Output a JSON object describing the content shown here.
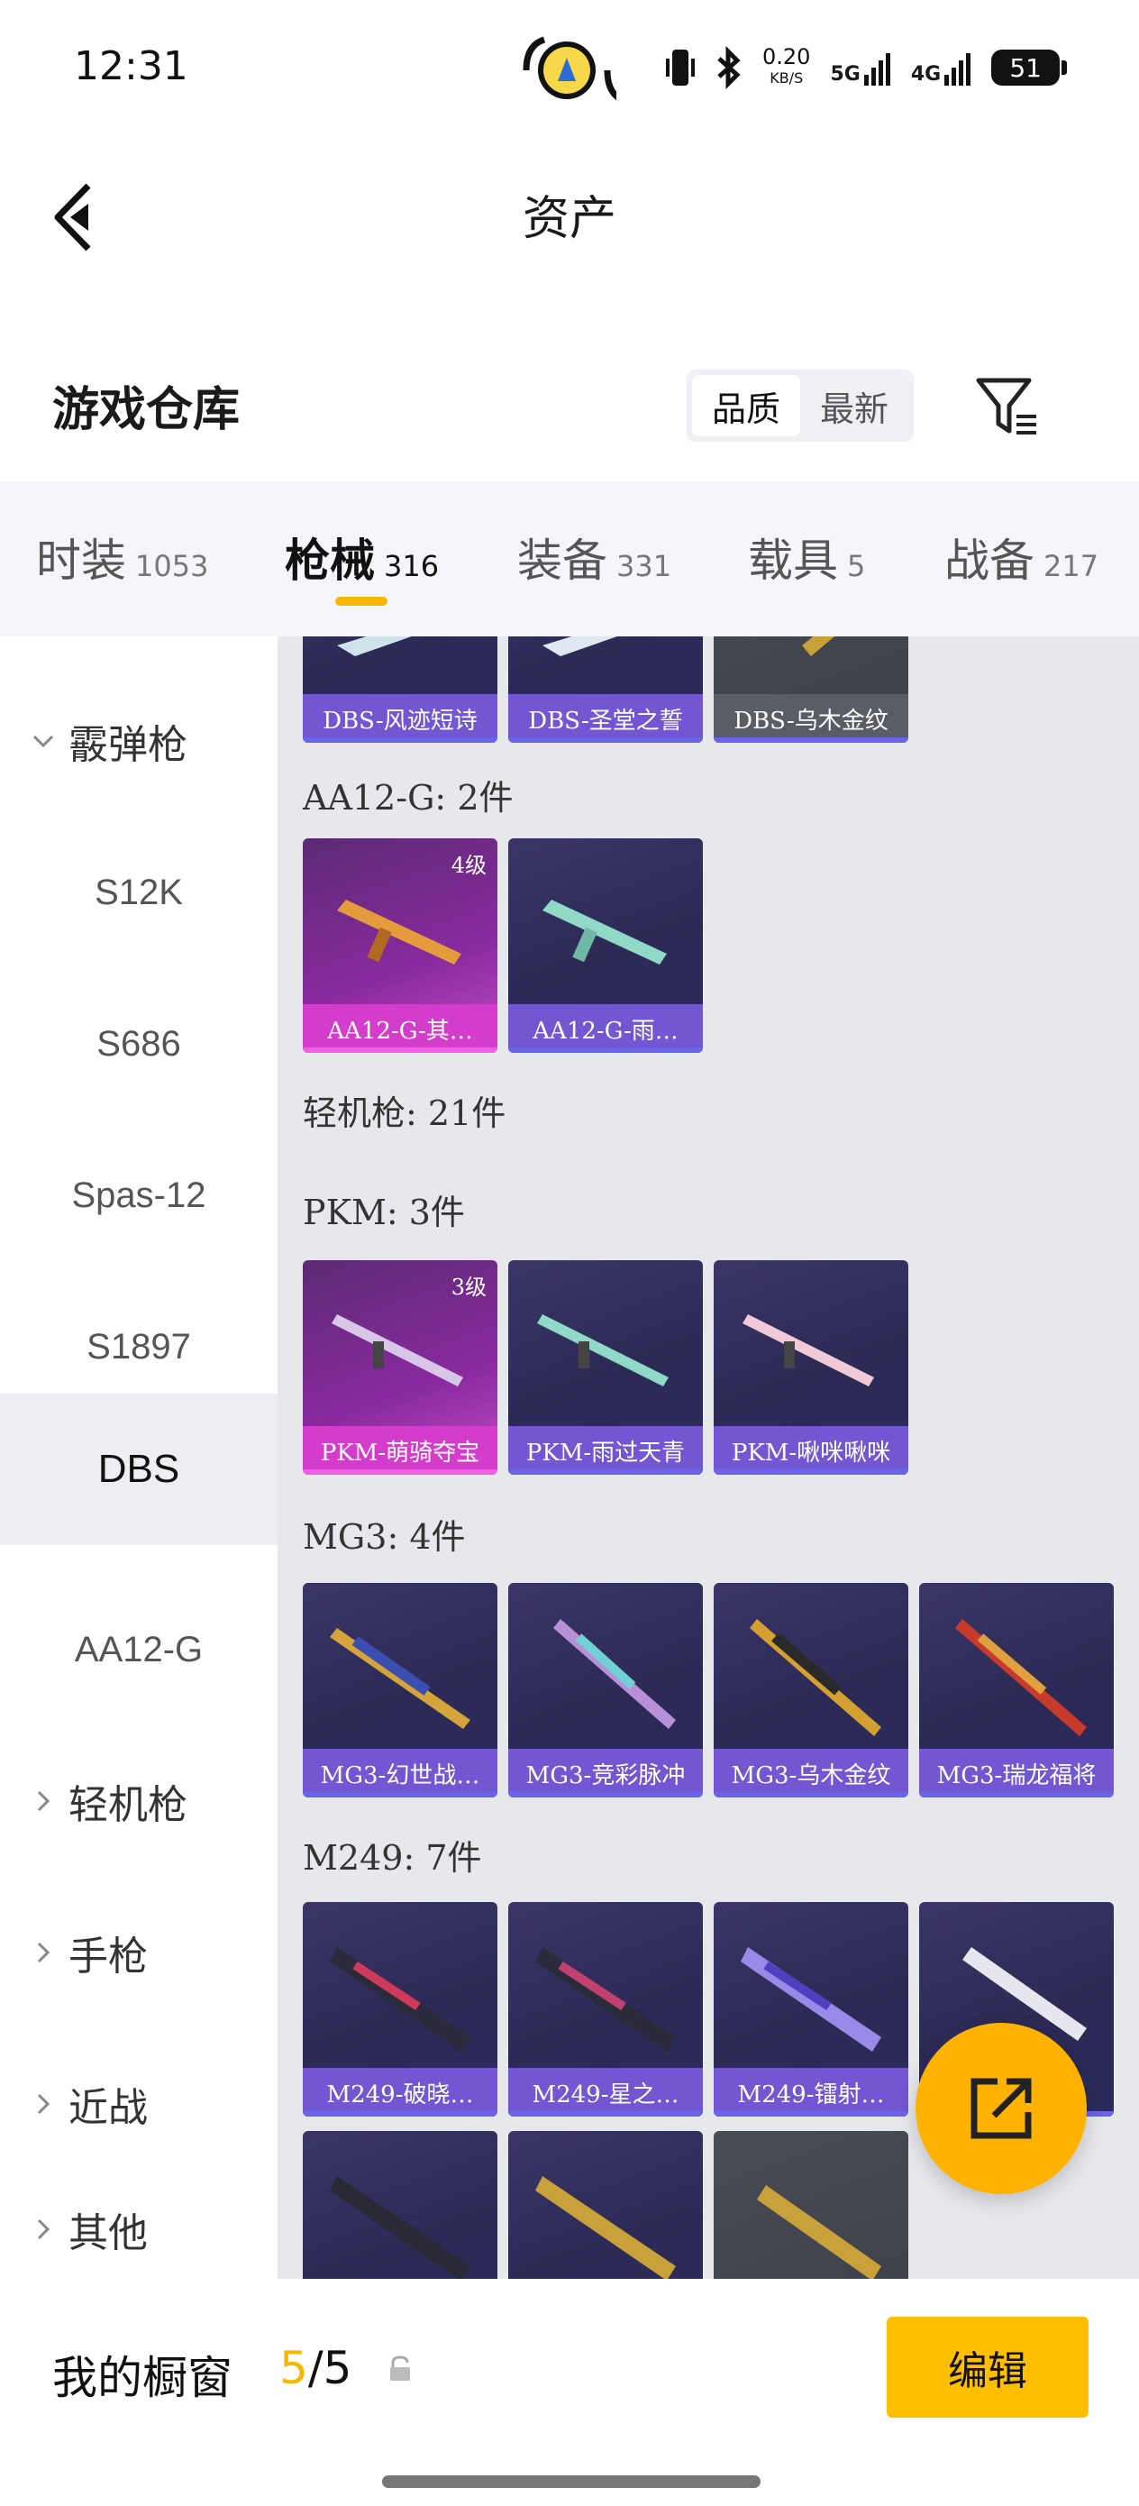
{
  "status_bar": {
    "time": "12:31",
    "net_speed_value": "0.20",
    "net_speed_unit": "KB/S",
    "signal1": "5G",
    "signal2": "4G",
    "battery": "51"
  },
  "header": {
    "title": "资产"
  },
  "warehouse": {
    "title": "游戏仓库",
    "sort_options": [
      "品质",
      "最新"
    ],
    "active_sort": "品质"
  },
  "tabs": [
    {
      "name": "时装",
      "count": "1053"
    },
    {
      "name": "枪械",
      "count": "316"
    },
    {
      "name": "装备",
      "count": "331"
    },
    {
      "name": "载具",
      "count": "5"
    },
    {
      "name": "战备",
      "count": "217"
    }
  ],
  "sidebar": {
    "group_open": "霰弹枪",
    "items": [
      "S12K",
      "S686",
      "Spas-12",
      "S1897",
      "DBS",
      "AA12-G"
    ],
    "selected": "DBS",
    "groups_closed": [
      "轻机枪",
      "手枪",
      "近战",
      "其他"
    ]
  },
  "content": {
    "top_row": [
      "DBS-风迹短诗",
      "DBS-圣堂之誓",
      "DBS-乌木金纹"
    ],
    "aa12_label": "AA12-G: 2件",
    "aa12_cards": [
      {
        "name": "AA12-G-其…",
        "level": "4级"
      },
      {
        "name": "AA12-G-雨…"
      }
    ],
    "lmg_label": "轻机枪: 21件",
    "pkm_label": "PKM: 3件",
    "pkm_cards": [
      {
        "name": "PKM-萌骑夺宝",
        "level": "3级"
      },
      {
        "name": "PKM-雨过天青"
      },
      {
        "name": "PKM-啾咪啾咪"
      }
    ],
    "mg3_label": "MG3: 4件",
    "mg3_cards": [
      "MG3-幻世战…",
      "MG3-竞彩脉冲",
      "MG3-乌木金纹",
      "MG3-瑞龙福将"
    ],
    "m249_label": "M249: 7件",
    "m249_cards": [
      "M249-破晓…",
      "M249-星之…",
      "M249-镭射…"
    ]
  },
  "bottom_bar": {
    "label": "我的橱窗",
    "current": "5",
    "total": "/5",
    "edit": "编辑"
  }
}
